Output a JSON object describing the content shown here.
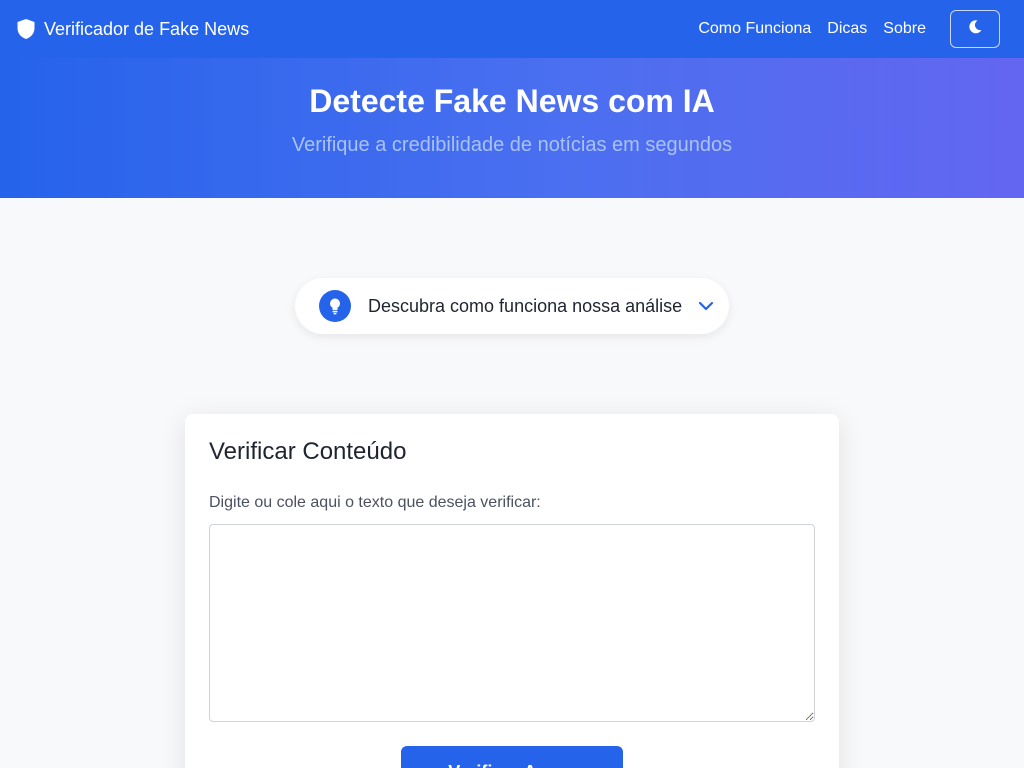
{
  "navbar": {
    "brand": "Verificador de Fake News",
    "brand_icon": "shield-icon",
    "links": [
      "Como Funciona",
      "Dicas",
      "Sobre"
    ],
    "theme_toggle_icon": "moon-icon"
  },
  "hero": {
    "title": "Detecte Fake News com IA",
    "subtitle": "Verifique a credibilidade de notícias em segundos"
  },
  "how_it_works": {
    "label": "Descubra como funciona nossa análise",
    "icon": "lightbulb-icon",
    "toggle_icon": "chevron-down-icon"
  },
  "verify_card": {
    "title": "Verificar Conteúdo",
    "field_label": "Digite ou cole aqui o texto que deseja verificar:",
    "textarea_value": "",
    "button_label": "Verificar Agora"
  },
  "colors": {
    "primary": "#2563eb",
    "gradient_end": "#6366f1",
    "background": "#f8f9fb"
  }
}
